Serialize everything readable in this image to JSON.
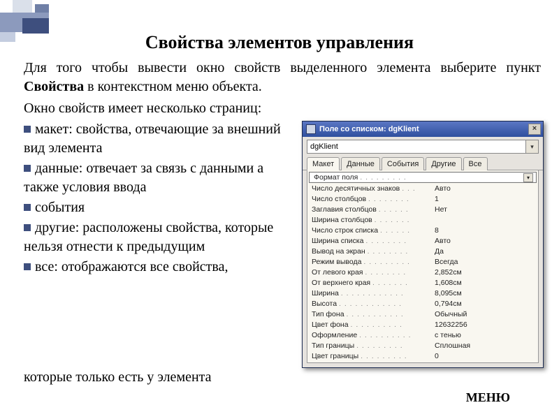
{
  "title": "Свойства элементов управления",
  "intro_before": "Для того чтобы вывести окно свойств выделенного элемента выберите пункт ",
  "intro_bold": "Свойства",
  "intro_after": " в контекстном меню объекта.",
  "subhead": "Окно свойств имеет несколько страниц:",
  "bullets": [
    "макет: свойства, отвечающие за внешний вид элемента",
    "данные: отвечает за связь с данными а также условия ввода",
    "события",
    "другие: расположены свойства, которые нельзя отнести к предыдущим",
    "все: отображаются все свойства,"
  ],
  "tail": "которые только есть у элемента",
  "menu_label": "МЕНЮ",
  "propwin": {
    "title": "Поле со списком: dgKlient",
    "close": "×",
    "combo_value": "dgKlient",
    "tabs": [
      "Макет",
      "Данные",
      "События",
      "Другие",
      "Все"
    ],
    "active_tab": 0,
    "rows": [
      {
        "k": "Формат поля",
        "v": ""
      },
      {
        "k": "Число десятичных знаков",
        "v": "Авто"
      },
      {
        "k": "Число столбцов",
        "v": "1"
      },
      {
        "k": "Заглавия столбцов",
        "v": "Нет"
      },
      {
        "k": "Ширина столбцов",
        "v": ""
      },
      {
        "k": "Число строк списка",
        "v": "8"
      },
      {
        "k": "Ширина списка",
        "v": "Авто"
      },
      {
        "k": "Вывод на экран",
        "v": "Да"
      },
      {
        "k": "Режим вывода",
        "v": "Всегда"
      },
      {
        "k": "От левого края",
        "v": "2,852см"
      },
      {
        "k": "От верхнего края",
        "v": "1,608см"
      },
      {
        "k": "Ширина",
        "v": "8,095см"
      },
      {
        "k": "Высота",
        "v": "0,794см"
      },
      {
        "k": "Тип фона",
        "v": "Обычный"
      },
      {
        "k": "Цвет фона",
        "v": "12632256"
      },
      {
        "k": "Оформление",
        "v": "с тенью"
      },
      {
        "k": "Тип границы",
        "v": "Сплошная"
      },
      {
        "k": "Цвет границы",
        "v": "0"
      }
    ],
    "selected_row": 0
  }
}
